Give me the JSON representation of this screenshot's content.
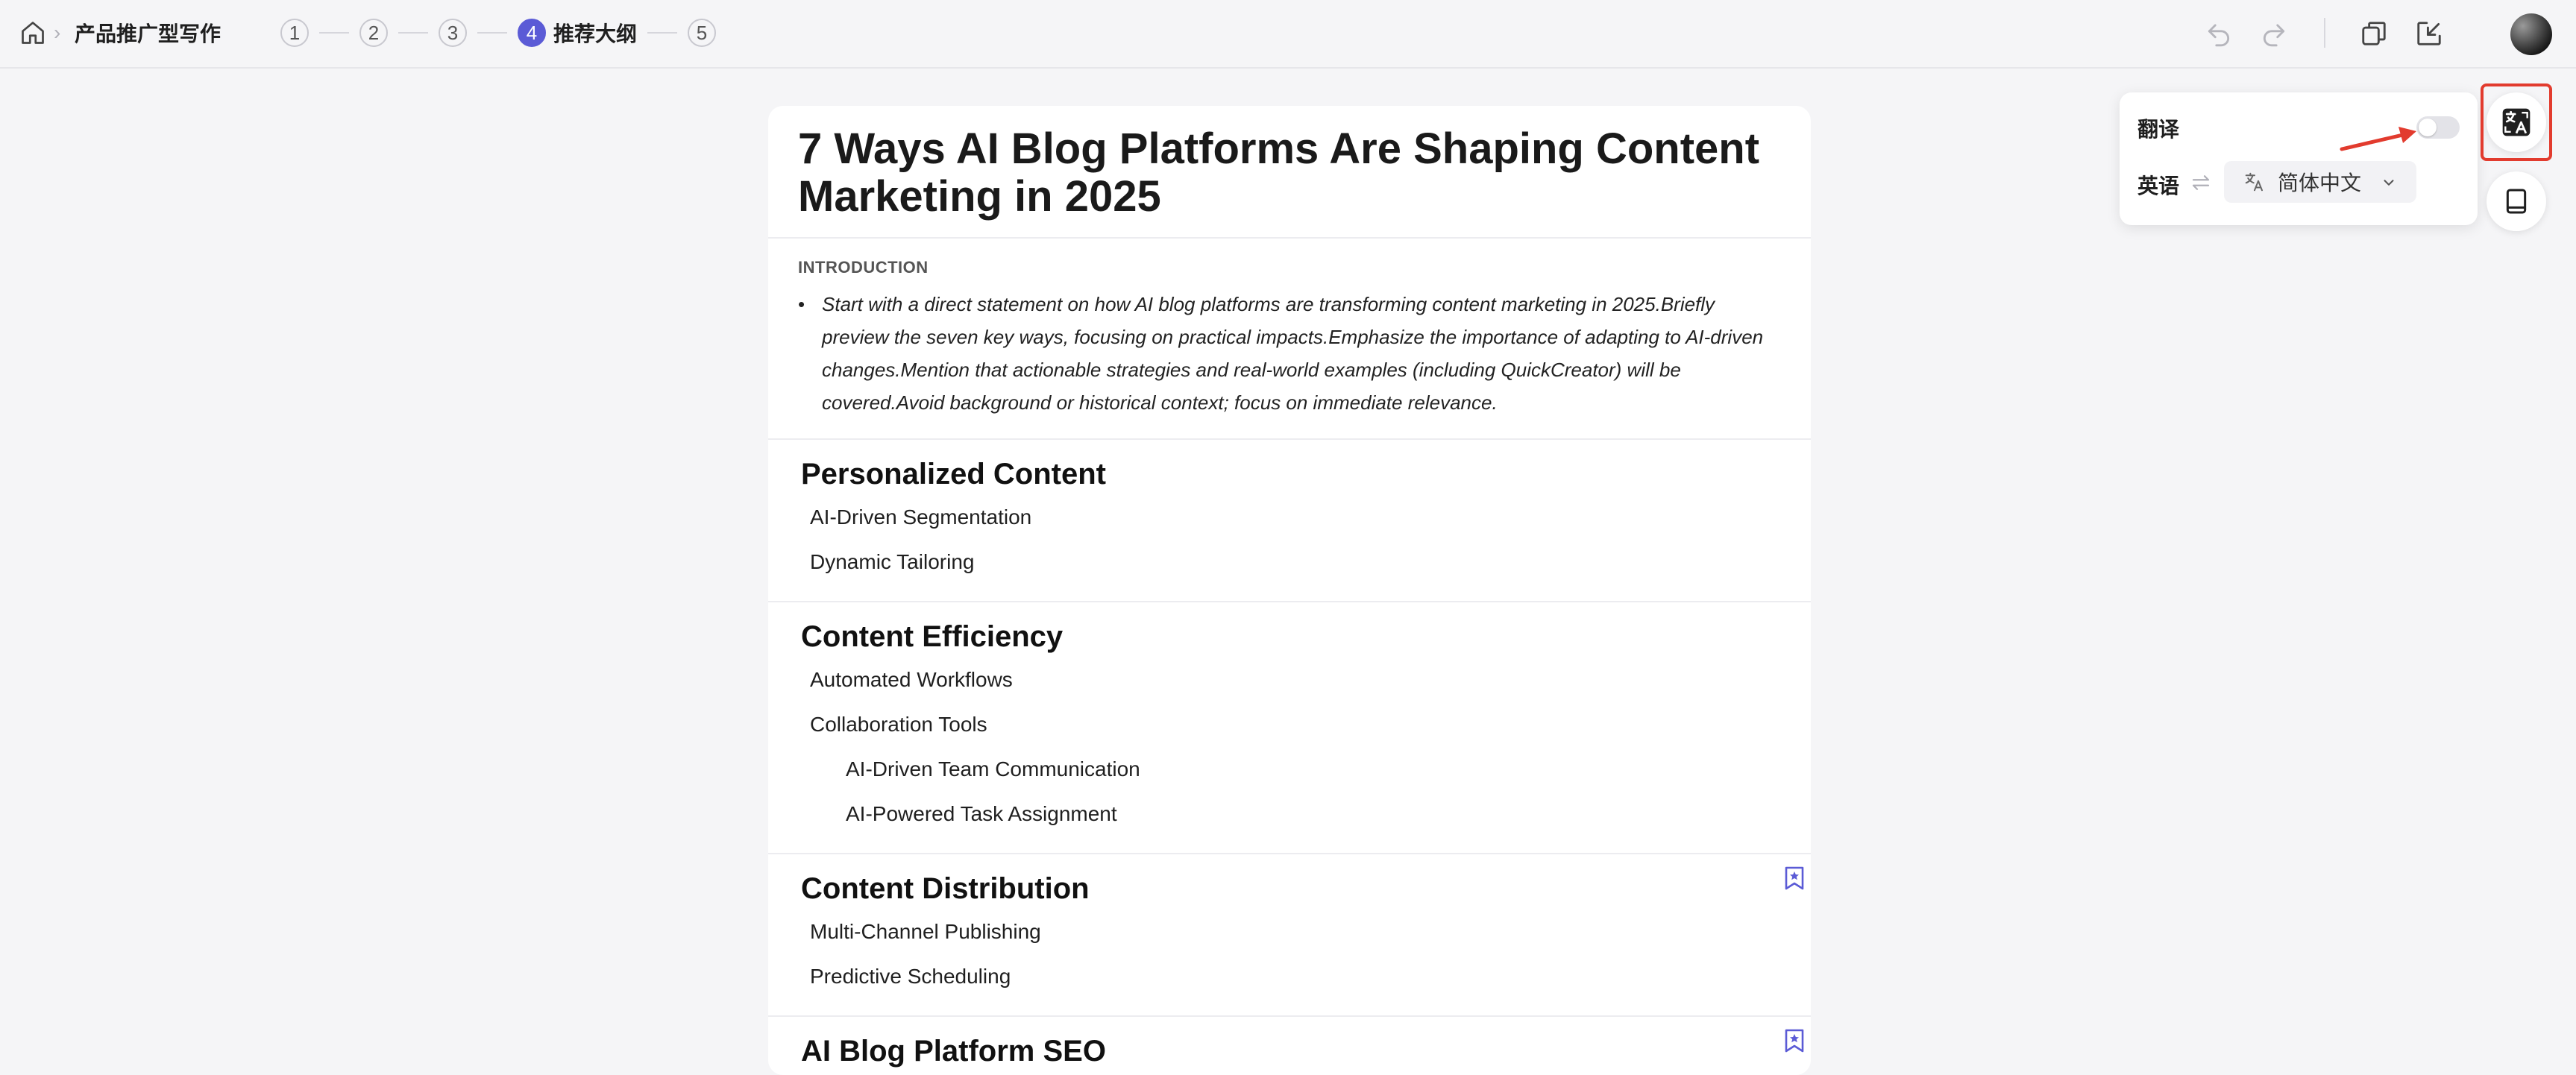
{
  "header": {
    "breadcrumb_sep": "›",
    "title": "产品推广型写作",
    "steps": [
      {
        "num": "1",
        "label": ""
      },
      {
        "num": "2",
        "label": ""
      },
      {
        "num": "3",
        "label": ""
      },
      {
        "num": "4",
        "label": "推荐大纲",
        "active": true
      },
      {
        "num": "5",
        "label": ""
      }
    ],
    "icons": [
      "home-icon",
      "undo-icon",
      "redo-icon",
      "copy-icon",
      "export-icon",
      "avatar"
    ]
  },
  "document": {
    "title": "7 Ways AI Blog Platforms Are Shaping Content Marketing in 2025",
    "intro_label": "INTRODUCTION",
    "intro_text": "Start with a direct statement on how AI blog platforms are transforming content marketing in 2025.Briefly preview the seven key ways, focusing on practical impacts.Emphasize the importance of adapting to AI-driven changes.Mention that actionable strategies and real-world examples (including QuickCreator) will be covered.Avoid background or historical context; focus on immediate relevance.",
    "sections": [
      {
        "title": "Personalized Content",
        "items": [
          "AI-Driven Segmentation",
          "Dynamic Tailoring"
        ]
      },
      {
        "title": "Content Efficiency",
        "items": [
          "Automated Workflows",
          "Collaboration Tools"
        ],
        "subitems": [
          "AI-Driven Team Communication",
          "AI-Powered Task Assignment"
        ]
      },
      {
        "title": "Content Distribution",
        "items": [
          "Multi-Channel Publishing",
          "Predictive Scheduling"
        ],
        "bookmarked": true
      },
      {
        "title": "AI Blog Platform SEO",
        "items": [],
        "bookmarked": true
      }
    ]
  },
  "translate_panel": {
    "title": "翻译",
    "toggle_on": false,
    "source_lang": "英语",
    "target_lang": "简体中文"
  },
  "colors": {
    "accent": "#5b5bd6",
    "highlight": "#e23b2e",
    "background": "#f5f5f7"
  }
}
